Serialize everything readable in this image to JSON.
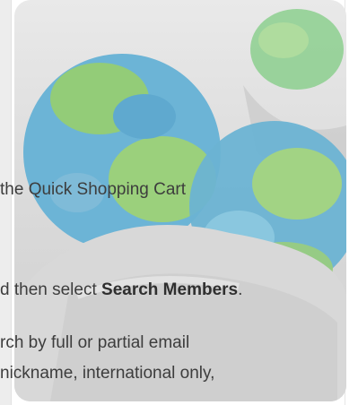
{
  "lines": {
    "l1": "the Quick Shopping Cart",
    "l2_prefix": "d then select ",
    "l2_bold": "Search Members",
    "l2_suffix": ".",
    "l3": "rch by full or partial email",
    "l4": "nickname, international only,"
  },
  "icon": "people-globe-icon"
}
